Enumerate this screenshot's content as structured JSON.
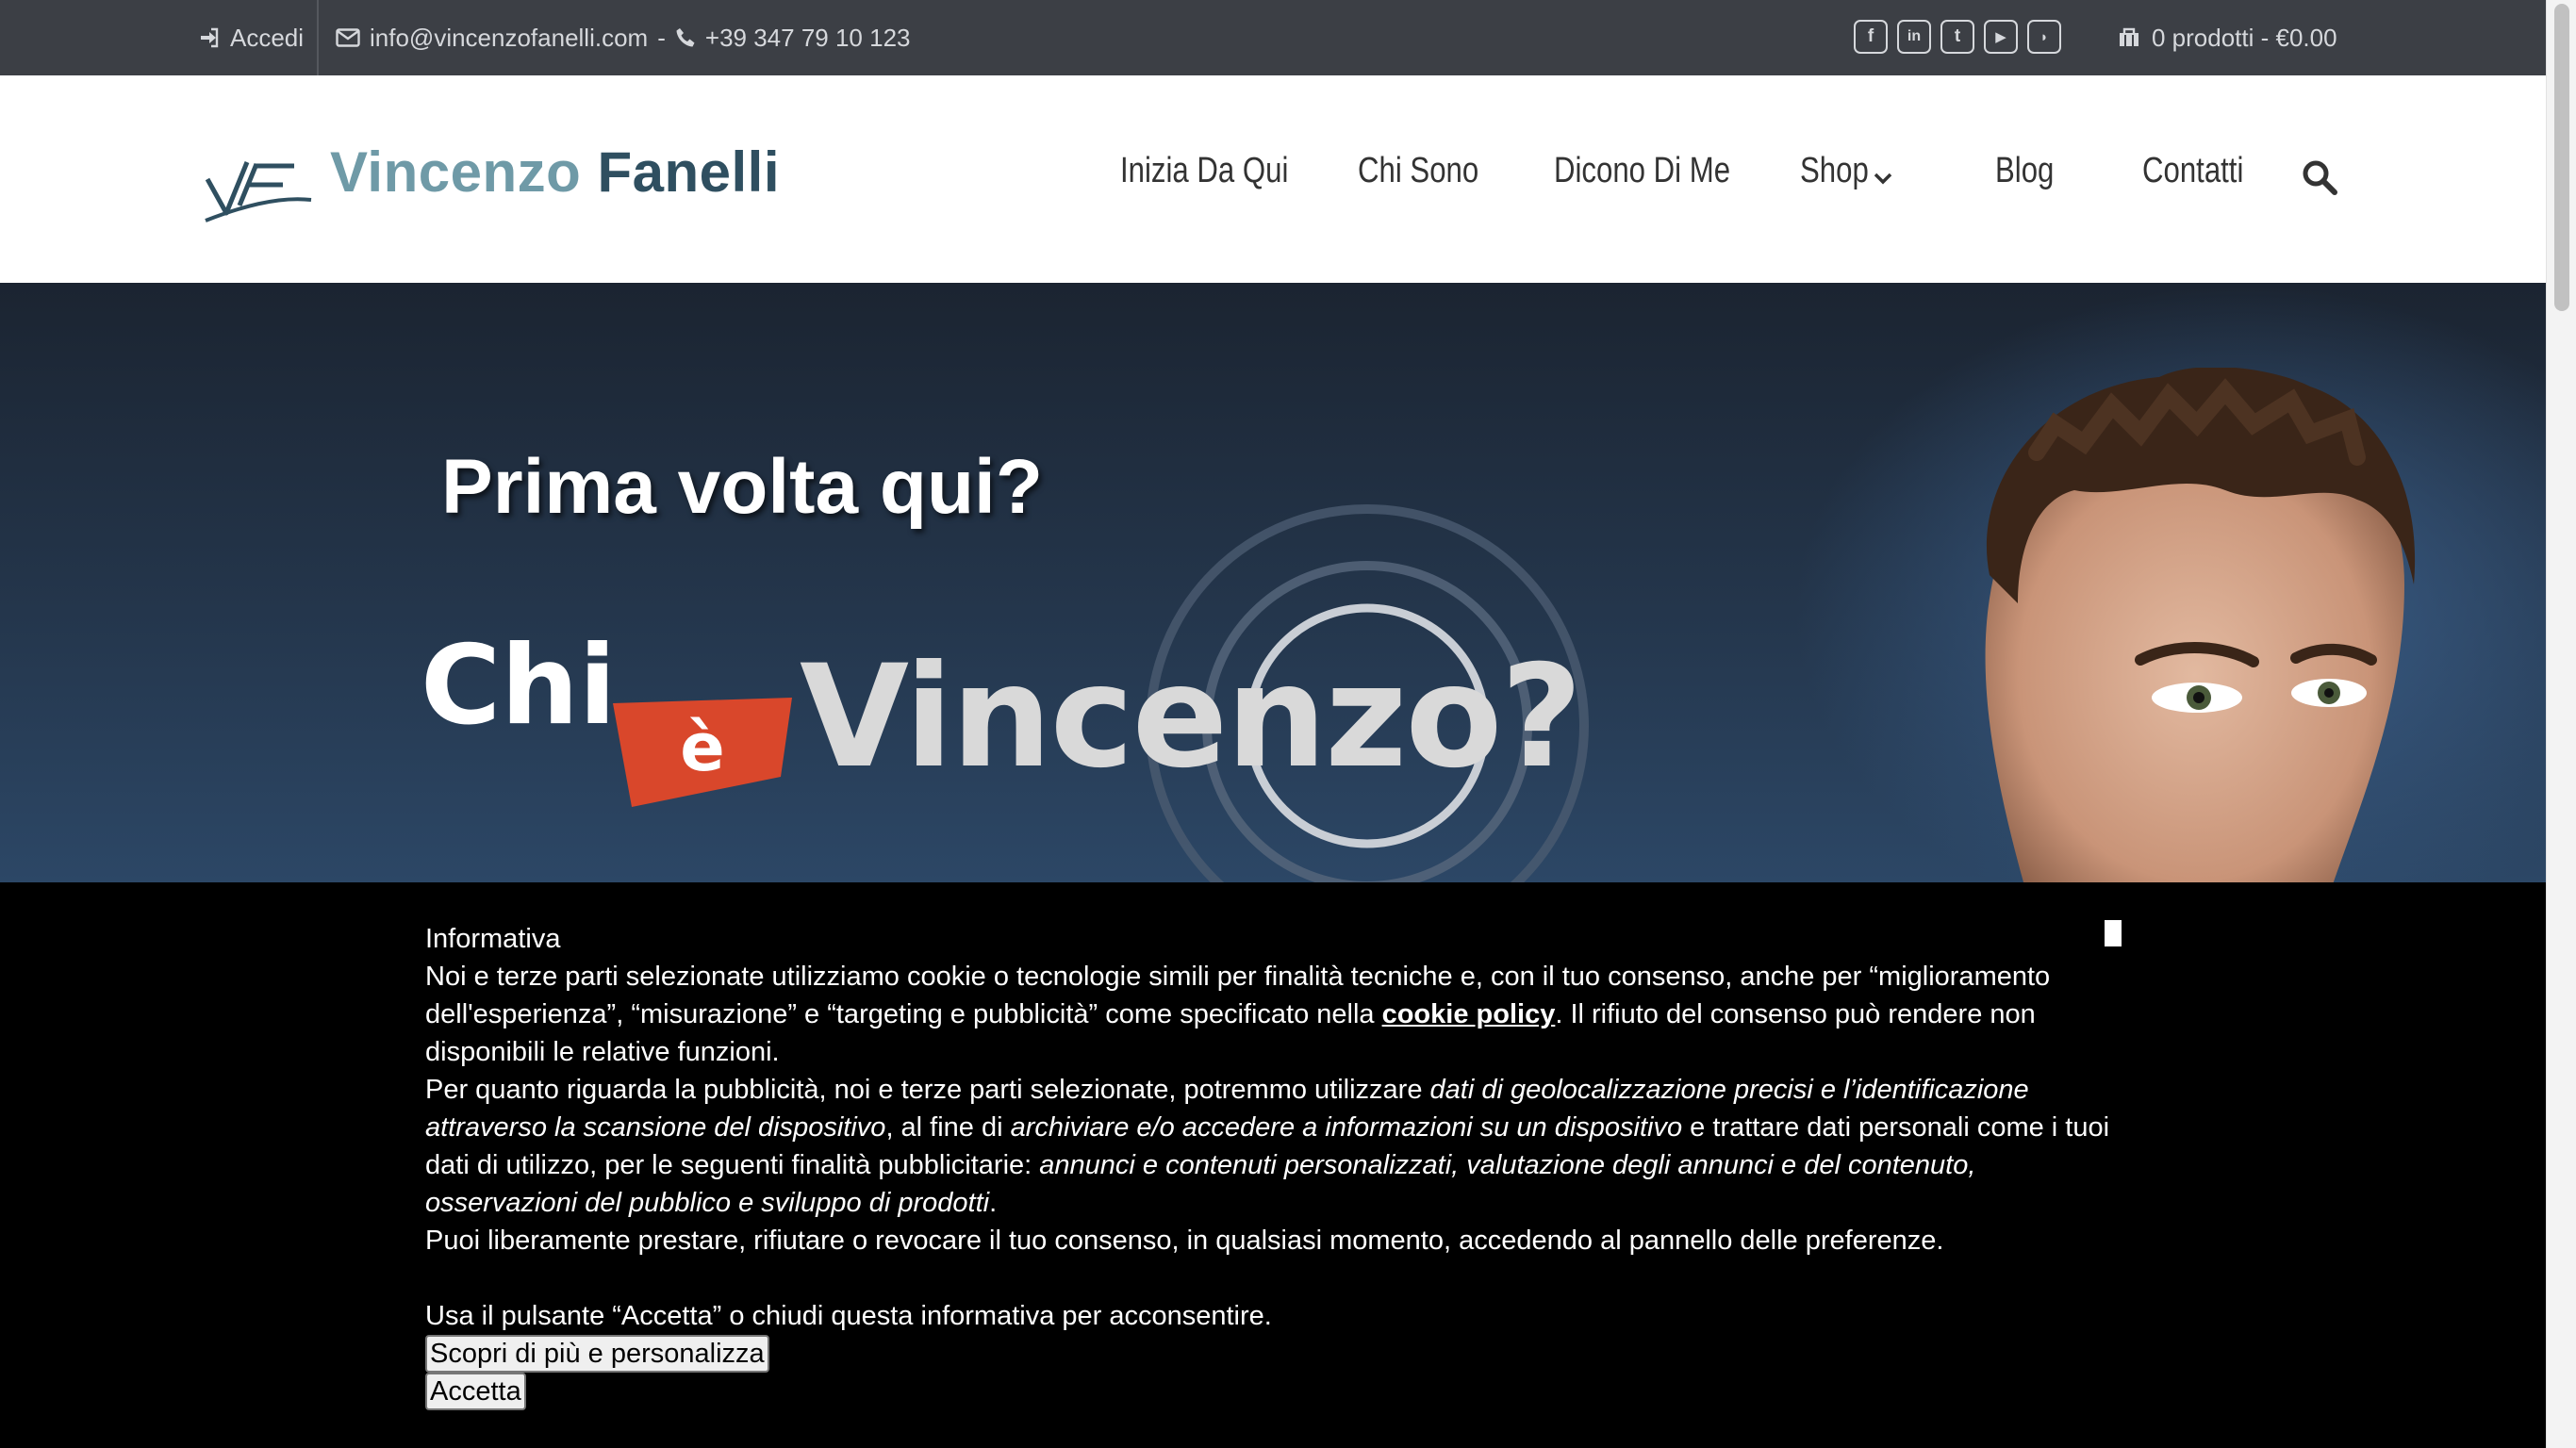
{
  "topbar": {
    "login_label": "Accedi",
    "email": "info@vincenzofanelli.com",
    "separator": "-",
    "phone": "+39 347 79 10 123",
    "socials": [
      {
        "name": "facebook",
        "glyph": "f"
      },
      {
        "name": "linkedin",
        "glyph": "in"
      },
      {
        "name": "twitter",
        "glyph": "t"
      },
      {
        "name": "youtube",
        "glyph": "▶"
      },
      {
        "name": "rss",
        "glyph": "◗"
      }
    ],
    "cart_label": "0 prodotti - €0.00"
  },
  "header": {
    "brand_first": "Vincenzo",
    "brand_last": "Fanelli",
    "nav": [
      "Inizia Da Qui",
      "Chi Sono",
      "Dicono Di Me",
      "Shop",
      "Blog",
      "Contatti"
    ]
  },
  "hero": {
    "title": "Prima volta qui?",
    "chi": "Chi",
    "e": "è",
    "vincenzo": "Vincenzo?"
  },
  "cookie": {
    "heading": "Informativa",
    "p1_before": "Noi e terze parti selezionate utilizziamo cookie o tecnologie simili per finalità tecniche e, con il tuo consenso, anche per “miglioramento dell'esperienza”, “misurazione” e “targeting e pubblicità” come specificato nella ",
    "p1_link": "cookie policy",
    "p1_after": ". Il rifiuto del consenso può rendere non disponibili le relative funzioni.",
    "p2_a": "Per quanto riguarda la pubblicità, noi e terze parti selezionate, potremmo utilizzare ",
    "p2_b": "dati di geolocalizzazione precisi e l’identificazione attraverso la scansione del dispositivo",
    "p2_c": ", al fine di ",
    "p2_d": "archiviare e/o accedere a informazioni su un dispositivo",
    "p2_e": " e trattare dati personali come i tuoi dati di utilizzo, per le seguenti finalità pubblicitarie: ",
    "p2_f": "annunci e contenuti personalizzati, valutazione degli annunci e del contenuto, osservazioni del pubblico e sviluppo di prodotti",
    "p2_g": ".",
    "p3": "Puoi liberamente prestare, rifiutare o revocare il tuo consenso, in qualsiasi momento, accedendo al pannello delle preferenze.",
    "p4": "Usa il pulsante “Accetta” o chiudi questa informativa per acconsentire.",
    "btn_more": "Scopri di più e personalizza",
    "btn_accept": "Accetta"
  },
  "colors": {
    "topbar_bg": "#3c3f45",
    "hero_bg": "#24364c",
    "badge_red": "#d9472b",
    "cookie_bg": "#000000"
  }
}
